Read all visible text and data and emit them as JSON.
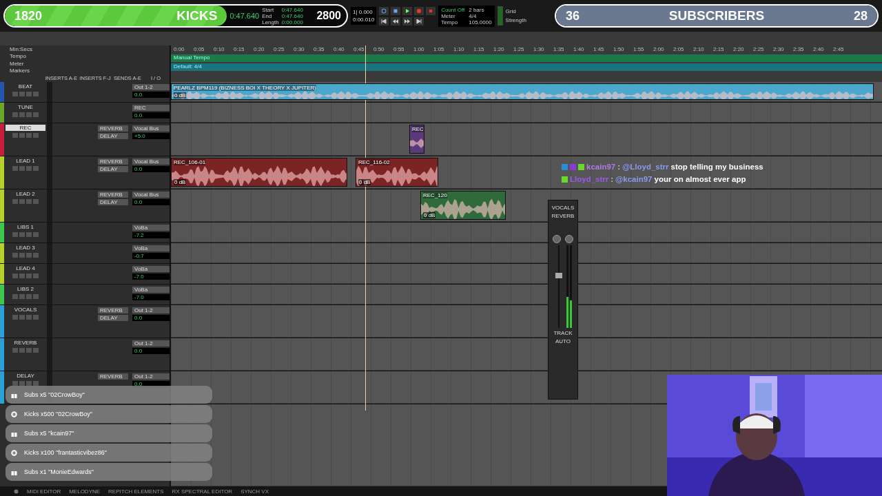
{
  "goals": [
    {
      "kind": "kicks",
      "current": "1820",
      "label": "KICKS",
      "target": "2800",
      "level": 0.65
    },
    {
      "kind": "subs",
      "current": "36",
      "label": "SUBSCRIBERS",
      "target": "28",
      "level": 1
    }
  ],
  "counter": {
    "main": "0:47.640",
    "fields": [
      {
        "label": "Start",
        "value": "0:47.640"
      },
      {
        "label": "End",
        "value": "0:47.640"
      },
      {
        "label": "Length",
        "value": "0:00.000"
      }
    ],
    "nudge": [
      "1| 0.000",
      "0:00.010"
    ]
  },
  "transport": {
    "count_off": "Count Off",
    "meter": "Meter",
    "tempo": "Tempo",
    "bars": "2 bars",
    "signature": "4/4",
    "bpm": "105.0000",
    "grid": "Grid",
    "strength": "Strength"
  },
  "rulers": [
    "Min:Secs",
    "Tempo",
    "Meter",
    "Markers"
  ],
  "ruler_ticks": [
    "0:00",
    "0:05",
    "0:10",
    "0:15",
    "0:20",
    "0:25",
    "0:30",
    "0:35",
    "0:40",
    "0:45",
    "0:50",
    "0:55",
    "1:00",
    "1:05",
    "1:10",
    "1:15",
    "1:20",
    "1:25",
    "1:30",
    "1:35",
    "1:40",
    "1:45",
    "1:50",
    "1:55",
    "2:00",
    "2:05",
    "2:10",
    "2:15",
    "2:20",
    "2:25",
    "2:30",
    "2:35",
    "2:40",
    "2:45"
  ],
  "tempo_lane": "Manual Tempo",
  "meter_lane": "Default: 4/4",
  "columns": [
    "INSERTS A-E",
    "INSERTS F-J",
    "SENDS A-E",
    "I / O"
  ],
  "tracks": [
    {
      "name": "BEAT",
      "color": "#2456b0",
      "kind": "short",
      "selected": false,
      "output": "Out 1-2",
      "vol": "0.0",
      "clips": [
        {
          "name": "PEARLZ BPM119 (BIZNESS BOI X THEORY X JUPITER)",
          "gain": "0 dB",
          "color": "#4aa8cc"
        }
      ]
    },
    {
      "name": "TUNE",
      "color": "#6aa82a",
      "kind": "short",
      "selected": false,
      "output": "REC",
      "vol": "0.0"
    },
    {
      "name": "REC",
      "color": "#c8203c",
      "kind": "tall",
      "selected": true,
      "output": "Vocal Bus",
      "vol": "+5.0",
      "sends": [
        "REVERB",
        "DELAY"
      ],
      "clips": [
        {
          "name": "REC",
          "color": "#5a3a78"
        }
      ]
    },
    {
      "name": "LEAD 1",
      "color": "#b8d02a",
      "kind": "tall",
      "selected": false,
      "output": "Vocal Bus",
      "vol": "0.0",
      "sends": [
        "REVERB",
        "DELAY"
      ],
      "clips": [
        {
          "name": "REC_106-01",
          "gain": "0 dB",
          "color": "#7a2424"
        },
        {
          "name": "REC_116-02",
          "gain": "0 dB",
          "color": "#7a2424"
        }
      ]
    },
    {
      "name": "LEAD 2",
      "color": "#b8d02a",
      "kind": "tall",
      "selected": false,
      "output": "Vocal Bus",
      "vol": "0.0",
      "sends": [
        "REVERB",
        "DELAY"
      ],
      "clips": [
        {
          "name": "REC_120",
          "gain": "0 dB",
          "color": "#2e6a3a"
        }
      ]
    },
    {
      "name": "LIBS 1",
      "color": "#3cc84a",
      "kind": "short",
      "selected": false,
      "output": "VoBa",
      "vol": "-7.2"
    },
    {
      "name": "LEAD 3",
      "color": "#b8d02a",
      "kind": "short",
      "selected": false,
      "output": "VoBa",
      "vol": "-0.7"
    },
    {
      "name": "LEAD 4",
      "color": "#b8d02a",
      "kind": "short",
      "selected": false,
      "output": "VoBa",
      "vol": "-7.0"
    },
    {
      "name": "LIBS 2",
      "color": "#3cc84a",
      "kind": "short",
      "selected": false,
      "output": "VoBa",
      "vol": "-7.0"
    },
    {
      "name": "VOCALS",
      "color": "#2aa0d8",
      "kind": "tall",
      "selected": false,
      "output": "Out 1-2",
      "vol": "0.0",
      "sends": [
        "REVERB",
        "DELAY"
      ]
    },
    {
      "name": "REVERB",
      "color": "#2aa0d8",
      "kind": "tall",
      "selected": false,
      "output": "Out 1-2",
      "vol": "0.0"
    },
    {
      "name": "DELAY",
      "color": "#2aa0d8",
      "kind": "tall",
      "selected": false,
      "output": "Out 1-2",
      "vol": "0.0",
      "sends": [
        "REVERB"
      ]
    }
  ],
  "chat": [
    {
      "badges": [
        {
          "color": "#2a8cd8"
        },
        {
          "color": "#8a3ad8"
        },
        {
          "color": "#6ad82a"
        }
      ],
      "user": "kcain97",
      "color": "#b07ae8",
      "separator": ":",
      "mention": "@Lloyd_strr",
      "text": "stop telling my business"
    },
    {
      "badges": [
        {
          "color": "#6ad82a"
        }
      ],
      "user": "Lloyd_strr",
      "color": "#9a5ae8",
      "separator": ":",
      "mention": "@kcain97",
      "text": "your on almost ever app"
    }
  ],
  "mixer": {
    "track": "VOCALS",
    "insert": "REVERB",
    "mode": "TRACK",
    "auto": "AUTO"
  },
  "alerts": [
    {
      "kind": "gift",
      "text": "Subs x5 \"02CrowBoy\""
    },
    {
      "kind": "kick",
      "text": "Kicks x500 \"02CrowBoy\""
    },
    {
      "kind": "gift",
      "text": "Subs x5 \"kcain97\""
    },
    {
      "kind": "kick",
      "text": "Kicks x100 \"frantasticvibez86\""
    },
    {
      "kind": "gift",
      "text": "Subs x1 \"MonieEdwards\""
    }
  ],
  "bottom_tabs": [
    "MIDI EDITOR",
    "MELODYNE",
    "REPITCH ELEMENTS",
    "RX SPECTRAL EDITOR",
    "SYNCH VX"
  ],
  "webcam": {
    "kind": "picture"
  }
}
